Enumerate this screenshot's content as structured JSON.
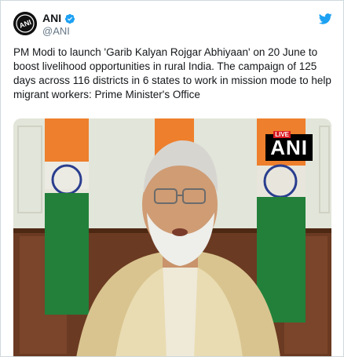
{
  "tweet": {
    "display_name": "ANI",
    "handle": "@ANI",
    "text": "PM Modi to launch 'Garib Kalyan Rojgar Abhiyaan' on 20 June to boost livelihood opportunities in rural India. The campaign of 125 days across 116 districts in 6 states to work in mission mode to help migrant workers: Prime Minister's Office",
    "avatar_text": "ANI"
  },
  "media": {
    "live_label": "LIVE",
    "logo_text": "ANI"
  },
  "icons": {
    "verified": "verified-badge-icon",
    "platform": "twitter-bird-icon"
  },
  "colors": {
    "accent": "#1da1f2",
    "text": "#14171a",
    "muted": "#657786",
    "live_red": "#d71921"
  }
}
